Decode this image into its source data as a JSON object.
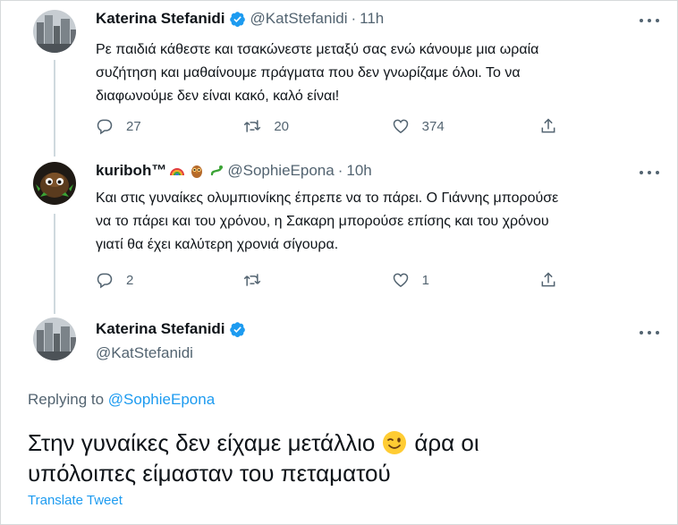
{
  "colors": {
    "accent": "#1d9bf0",
    "secondary_text": "#536471",
    "primary_text": "#0f1419",
    "thread_line": "#cfd9de"
  },
  "tweet1": {
    "name": "Katerina Stefanidi",
    "handle": "@KatStefanidi",
    "separator": "·",
    "time": "11h",
    "text_lines": [
      "Ρε παιδιά κάθεστε και τσακώνεστε μεταξύ σας ενώ κάνουμε μια ωραία",
      "συζήτηση και μαθαίνουμε πράγματα που δεν γνωρίζαμε όλοι. Το να",
      "διαφωνούμε δεν είναι κακό, καλό είναι!"
    ],
    "replies": "27",
    "retweets": "20",
    "likes": "374"
  },
  "tweet2": {
    "name": "kuriboh™",
    "name_emojis": [
      "rainbow-emoji",
      "owl-emoji",
      "snake-emoji"
    ],
    "handle": "@SophieEpona",
    "separator": "·",
    "time": "10h",
    "text_lines": [
      "Και στις γυναίκες ολυμπιονίκης έπρεπε να το πάρει. Ο Γιάννης μπορούσε",
      "να το πάρει και του χρόνου, η Σακαρη μπορούσε επίσης και του χρόνου",
      "γιατί θα έχει καλύτερη χρονιά σίγουρα."
    ],
    "replies": "2",
    "retweets": "",
    "likes": "1"
  },
  "tweet3": {
    "name": "Katerina Stefanidi",
    "handle": "@KatStefanidi",
    "replying_label": "Replying to",
    "replying_handle": "@SophieEpona",
    "text_line1": "Στην γυναίκες δεν είχαμε μετάλλιο",
    "emoji": "winking-face-emoji",
    "text_line1_after": "άρα οι",
    "text_line2": "υπόλοιπες είμασταν του πεταματού",
    "translate_label": "Translate Tweet"
  }
}
